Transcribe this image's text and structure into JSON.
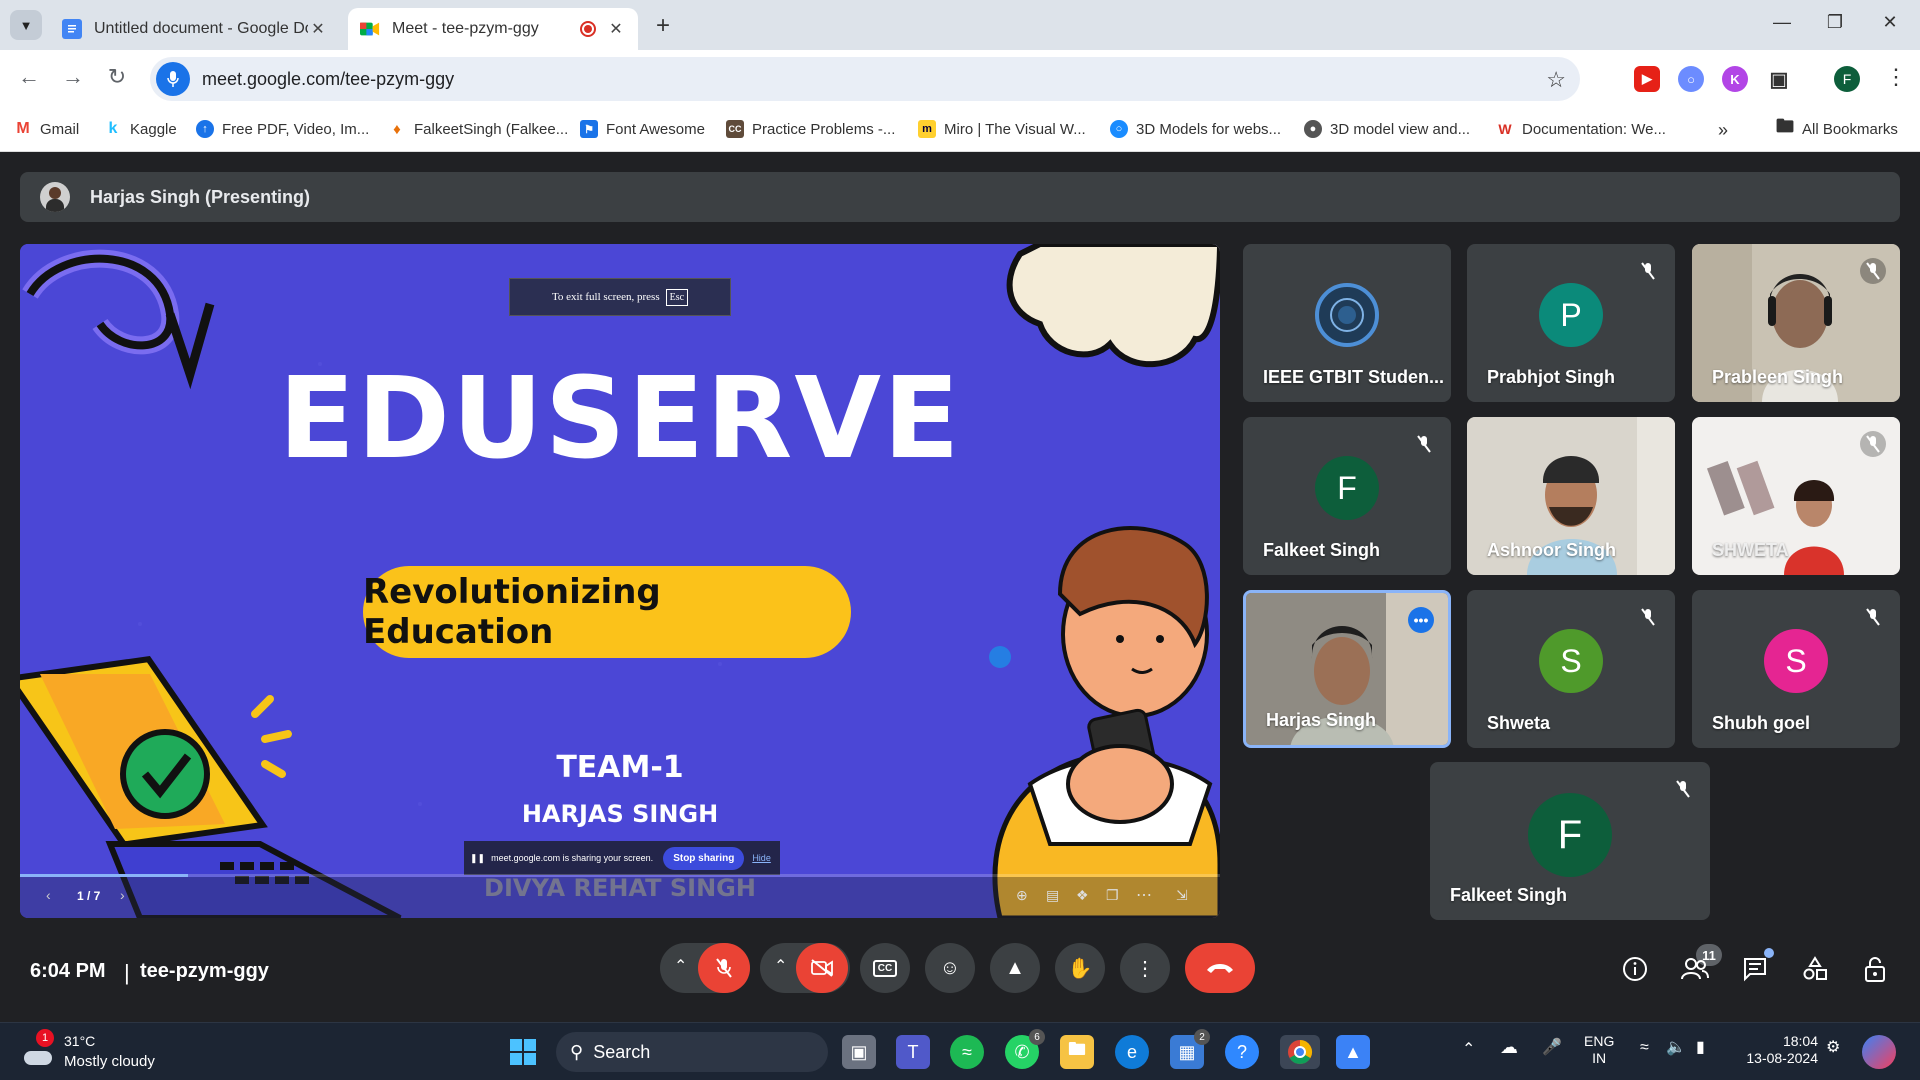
{
  "tabs": [
    {
      "title": "Untitled document - Google Docs",
      "favicon": "docs-icon"
    },
    {
      "title": "Meet - tee-pzym-ggy",
      "favicon": "meet-icon",
      "recording": true
    }
  ],
  "address_bar": {
    "url": "meet.google.com/tee-pzym-ggy"
  },
  "bookmarks": [
    {
      "label": "Gmail",
      "color": "#ea4335"
    },
    {
      "label": "Kaggle",
      "color": "#20beff"
    },
    {
      "label": "Free PDF, Video, Im...",
      "color": "#1a73e8"
    },
    {
      "label": "FalkeetSingh (Falkee...",
      "color": "#e8710a"
    },
    {
      "label": "Font Awesome",
      "color": "#1a73e8"
    },
    {
      "label": "Practice Problems -...",
      "color": "#5f4b3a"
    },
    {
      "label": "Miro | The Visual W...",
      "color": "#ffd02f"
    },
    {
      "label": "3D Models for webs...",
      "color": "#1a8cff"
    },
    {
      "label": "3D model view and...",
      "color": "#555555"
    },
    {
      "label": "Documentation: We...",
      "color": "#d93025"
    }
  ],
  "all_bookmarks": "All Bookmarks",
  "presenting_bar": {
    "text": "Harjas Singh (Presenting)"
  },
  "slide": {
    "fullscreen_hint": "To exit full screen, press",
    "esc_key": "Esc",
    "title": "EDUSERVE",
    "pill": "Revolutionizing Education",
    "team": "TEAM-1",
    "member1": "HARJAS SINGH",
    "member2": "DIVYA REHAT SINGH",
    "sharing_text": "meet.google.com is sharing your screen.",
    "stop_sharing": "Stop sharing",
    "hide": "Hide",
    "page_indicator": "1 / 7",
    "progress": 0.14
  },
  "participants": [
    {
      "name": "IEEE GTBIT Studen...",
      "type": "logo",
      "muted": false
    },
    {
      "name": "Prabhjot Singh",
      "initial": "P",
      "color": "#0b8a7a",
      "muted": true
    },
    {
      "name": "Prableen Singh",
      "type": "photo",
      "muted": true
    },
    {
      "name": "Falkeet Singh",
      "initial": "F",
      "color": "#0d5e3b",
      "muted": true
    },
    {
      "name": "Ashnoor Singh",
      "type": "photo",
      "muted": false
    },
    {
      "name": "SHWETA",
      "type": "photo",
      "muted": true
    },
    {
      "name": "Harjas Singh",
      "type": "photo",
      "muted": false,
      "speaking": true
    },
    {
      "name": "Shweta",
      "initial": "S",
      "color": "#4f9a2b",
      "muted": true
    },
    {
      "name": "Shubh goel",
      "initial": "S",
      "color": "#e52592",
      "muted": true
    },
    {
      "name": "Falkeet Singh",
      "initial": "F",
      "color": "#0d5e3b",
      "muted": true
    }
  ],
  "controls": {
    "time": "6:04 PM",
    "separator": "|",
    "meeting_code": "tee-pzym-ggy",
    "participant_count": "11"
  },
  "taskbar": {
    "weather_badge": "1",
    "temp": "31°C",
    "condition": "Mostly cloudy",
    "search": "Search",
    "whatsapp_badge": "6",
    "store_badge": "2",
    "lang1": "ENG",
    "lang2": "IN",
    "time": "18:04",
    "date": "13-08-2024"
  }
}
